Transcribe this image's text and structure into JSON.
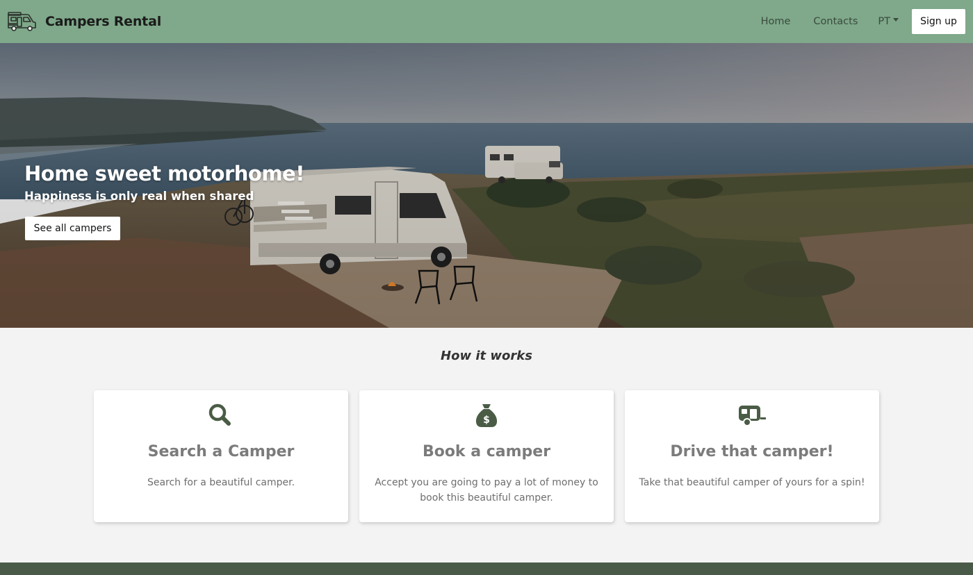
{
  "brand": {
    "name": "Campers Rental",
    "logo_icon": "campervan-icon"
  },
  "nav": {
    "home": "Home",
    "contacts": "Contacts",
    "language": "PT",
    "signup": "Sign up"
  },
  "hero": {
    "title": "Home sweet motorhome!",
    "subtitle": "Happiness is only real when shared",
    "cta": "See all campers"
  },
  "how_it_works": {
    "title": "How it works",
    "cards": [
      {
        "icon": "search-icon",
        "title": "Search a Camper",
        "text": "Search for a beautiful camper."
      },
      {
        "icon": "money-bag-icon",
        "title": "Book a camper",
        "text": "Accept you are going to pay a lot of money to book this beautiful camper."
      },
      {
        "icon": "caravan-icon",
        "title": "Drive that camper!",
        "text": "Take that beautiful camper of yours for a spin!"
      }
    ]
  },
  "colors": {
    "navbar": "#7fa98a",
    "icon": "#4a5c45",
    "footer": "#4a5a48",
    "page_bg": "#f3f3f3"
  }
}
